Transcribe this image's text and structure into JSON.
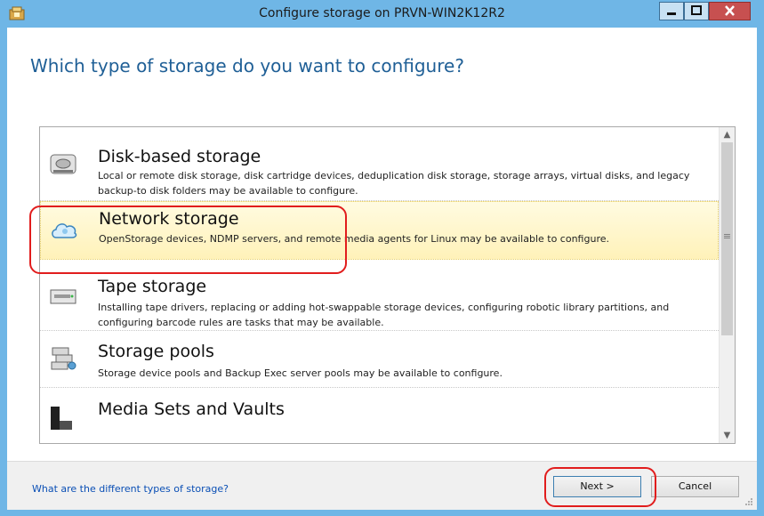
{
  "window": {
    "title": "Configure storage on PRVN-WIN2K12R2"
  },
  "main": {
    "heading": "Which type of storage do you want to configure?"
  },
  "storage_types": [
    {
      "title": "Disk-based storage",
      "description": "Local or remote disk storage, disk cartridge devices, deduplication disk storage, storage arrays, virtual disks, and legacy backup-to disk folders may be available to configure.",
      "icon": "disk-drive-icon",
      "selected": false
    },
    {
      "title": "Network storage",
      "description": "OpenStorage devices, NDMP servers, and remote media agents for Linux may be available to configure.",
      "icon": "cloud-icon",
      "selected": true
    },
    {
      "title": "Tape storage",
      "description": "Installing tape drivers, replacing or adding hot-swappable storage devices, configuring robotic library partitions, and configuring barcode rules are tasks that may be available.",
      "icon": "tape-drive-icon",
      "selected": false
    },
    {
      "title": "Storage pools",
      "description": "Storage device pools and Backup Exec server pools may be available to configure.",
      "icon": "storage-pool-icon",
      "selected": false
    },
    {
      "title": "Media Sets and Vaults",
      "description": "",
      "icon": "media-sets-icon",
      "selected": false
    }
  ],
  "footer": {
    "help_link": "What are the different types of storage?",
    "next_label": "Next >",
    "cancel_label": "Cancel"
  },
  "colors": {
    "accent": "#6fb6e6",
    "heading": "#1f5f96",
    "selected_bg": "#fff4c4",
    "annotation": "#e11d1d"
  }
}
